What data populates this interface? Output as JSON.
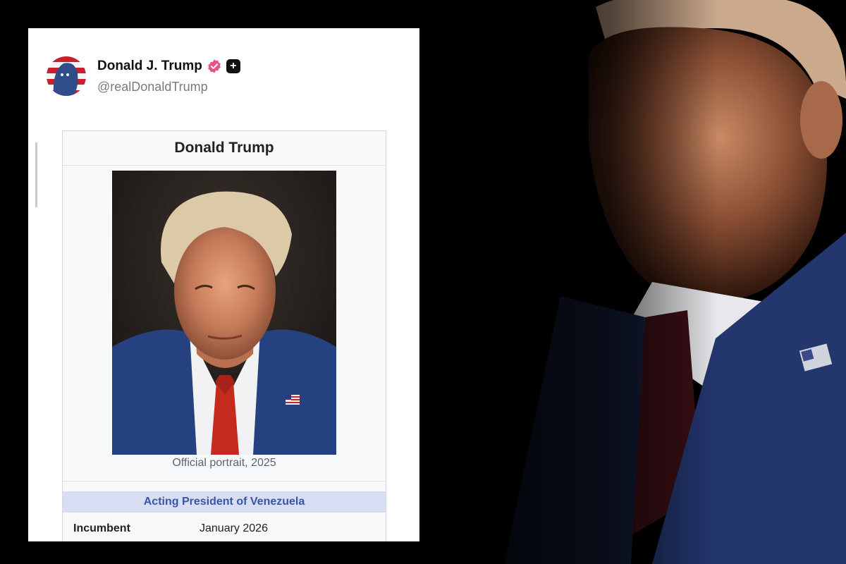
{
  "post": {
    "author_name": "Donald J. Trump",
    "handle": "@realDonaldTrump",
    "verified_icon": "verified-badge-icon",
    "plus_icon": "plus-badge-icon",
    "plus_symbol": "+"
  },
  "infobox": {
    "title": "Donald Trump",
    "image_caption": "Official portrait, 2025",
    "office_header": "Acting President of Venezuela",
    "rows": [
      {
        "label": "Incumbent",
        "value": "January 2026"
      }
    ]
  },
  "colors": {
    "verified": "#e5538a",
    "office_header_bg": "#d8ddf4",
    "office_header_text": "#3857a3"
  }
}
